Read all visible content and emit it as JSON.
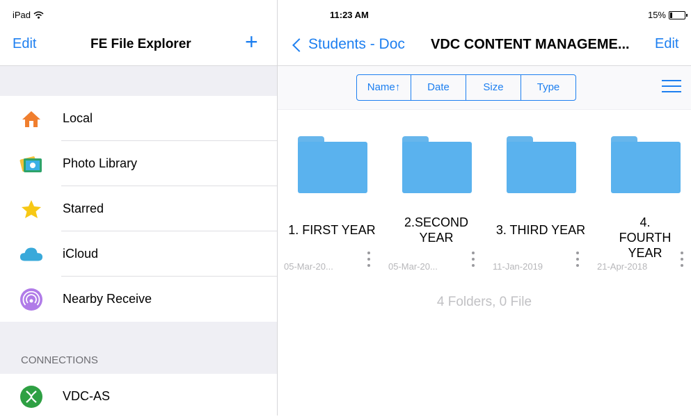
{
  "status": {
    "device": "iPad",
    "time": "11:23 AM",
    "battery": "15%",
    "battery_level": 0.15
  },
  "left_nav": {
    "edit": "Edit",
    "title": "FE File Explorer",
    "add": "+"
  },
  "locations": [
    {
      "label": "Local",
      "icon": "home-icon"
    },
    {
      "label": "Photo Library",
      "icon": "photo-library-icon"
    },
    {
      "label": "Starred",
      "icon": "star-icon"
    },
    {
      "label": "iCloud",
      "icon": "cloud-icon"
    },
    {
      "label": "Nearby Receive",
      "icon": "nearby-receive-icon"
    }
  ],
  "connections": {
    "header": "CONNECTIONS",
    "items": [
      {
        "label": "VDC-AS",
        "icon": "xbox-icon",
        "color": "#2ea043"
      }
    ]
  },
  "right_nav": {
    "back": "Students - Doc",
    "title": "VDC CONTENT MANAGEME...",
    "edit": "Edit"
  },
  "sort": {
    "name": "Name↑",
    "date": "Date",
    "size": "Size",
    "type": "Type"
  },
  "folders": [
    {
      "name": "1. FIRST YEAR",
      "date": "05-Mar-20..."
    },
    {
      "name": "2.SECOND YEAR",
      "date": "05-Mar-20..."
    },
    {
      "name": "3. THIRD YEAR",
      "date": "11-Jan-2019"
    },
    {
      "name": "4. FOURTH YEAR",
      "date": "21-Apr-2018"
    }
  ],
  "summary": "4 Folders, 0 File",
  "colors": {
    "accent": "#1d7ff0",
    "folder": "#5ab2ee"
  }
}
